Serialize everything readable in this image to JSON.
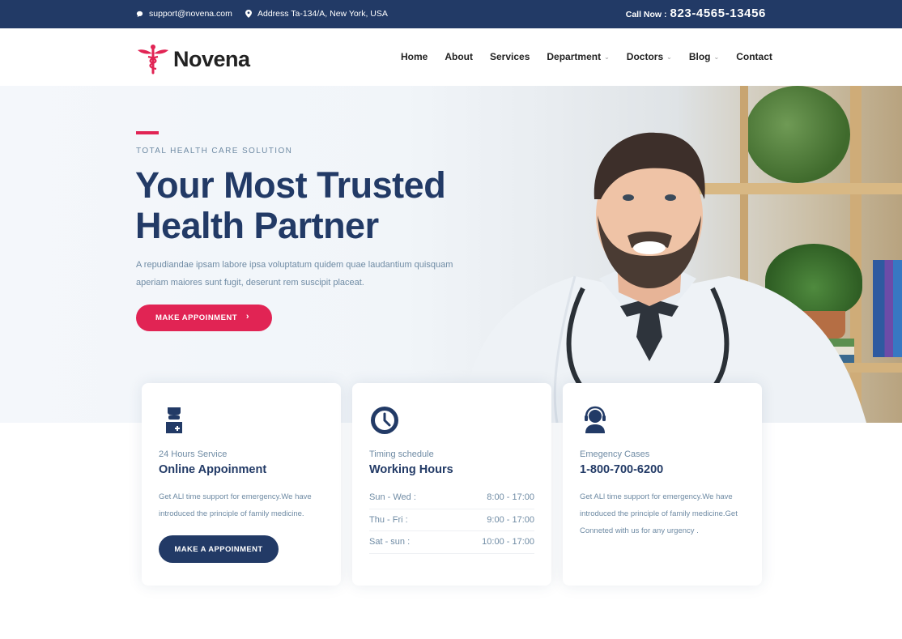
{
  "topbar": {
    "email": "support@novena.com",
    "address": "Address Ta-134/A, New York, USA",
    "call_label": "Call Now :",
    "phone": "823-4565-13456"
  },
  "brand": {
    "name": "Novena",
    "logo_icon": "caduceus-icon",
    "accent": "#e12454",
    "primary": "#223a66"
  },
  "nav": {
    "items": [
      {
        "label": "Home",
        "dropdown": false
      },
      {
        "label": "About",
        "dropdown": false
      },
      {
        "label": "Services",
        "dropdown": false
      },
      {
        "label": "Department",
        "dropdown": true
      },
      {
        "label": "Doctors",
        "dropdown": true
      },
      {
        "label": "Blog",
        "dropdown": true
      },
      {
        "label": "Contact",
        "dropdown": false
      }
    ]
  },
  "hero": {
    "kicker": "TOTAL HEALTH CARE SOLUTION",
    "title": "Your Most Trusted Health Partner",
    "description": "A repudiandae ipsam labore ipsa voluptatum quidem quae laudantium quisquam aperiam maiores sunt fugit, deserunt rem suscipit placeat.",
    "button": "MAKE APPOINMENT"
  },
  "cards": [
    {
      "icon": "doctor-icon",
      "subtitle": "24 Hours Service",
      "title": "Online Appoinment",
      "text": "Get ALl time support for emergency.We have introduced the principle of family medicine.",
      "button": "MAKE A APPOINMENT"
    },
    {
      "icon": "clock-icon",
      "subtitle": "Timing schedule",
      "title": "Working Hours",
      "hours": [
        {
          "day": "Sun - Wed :",
          "time": "8:00 - 17:00"
        },
        {
          "day": "Thu - Fri :",
          "time": "9:00 - 17:00"
        },
        {
          "day": "Sat - sun :",
          "time": "10:00 - 17:00"
        }
      ]
    },
    {
      "icon": "support-agent-icon",
      "subtitle": "Emegency Cases",
      "title": "1-800-700-6200",
      "text": "Get ALl time support for emergency.We have introduced the principle of family medicine.Get Conneted with us for any urgency ."
    }
  ]
}
